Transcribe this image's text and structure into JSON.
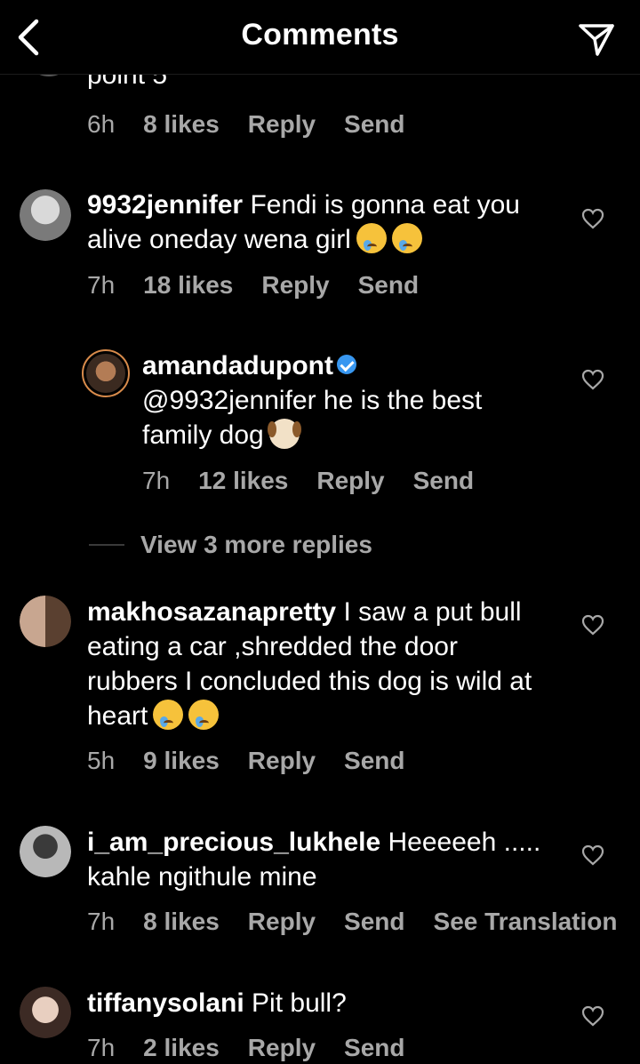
{
  "header": {
    "title": "Comments"
  },
  "partial": {
    "text": "point 5",
    "time": "6h",
    "likes": "8 likes",
    "reply": "Reply",
    "send": "Send"
  },
  "comments": [
    {
      "username": "9932jennifer",
      "text": "Fendi is gonna eat you alive oneday wena girl",
      "emojis": [
        "crying-face",
        "crying-face"
      ],
      "time": "7h",
      "likes": "18 likes",
      "reply": "Reply",
      "send": "Send"
    },
    {
      "username": "amandadupont",
      "verified": true,
      "text": "@9932jennifer he is the best family dog",
      "emojis": [
        "dog-face"
      ],
      "time": "7h",
      "likes": "12 likes",
      "reply": "Reply",
      "send": "Send"
    },
    {
      "username": "makhosazanapretty",
      "text": "I saw a put bull eating a car ,shredded the door rubbers I concluded this dog is wild at heart",
      "emojis": [
        "crying-face",
        "crying-face"
      ],
      "time": "5h",
      "likes": "9 likes",
      "reply": "Reply",
      "send": "Send"
    },
    {
      "username": "i_am_precious_lukhele",
      "text": "Heeeeeh ..... kahle ngithule mine",
      "time": "7h",
      "likes": "8 likes",
      "reply": "Reply",
      "send": "Send",
      "translate": "See Translation"
    },
    {
      "username": "tiffanysolani",
      "text": "Pit bull?",
      "time": "7h",
      "likes": "2 likes",
      "reply": "Reply",
      "send": "Send"
    }
  ],
  "view_more": "View 3 more replies",
  "colors": {
    "background": "#000000",
    "text": "#ffffff",
    "muted": "#a8a8a8",
    "verified": "#3897f0",
    "story_ring": "#d88b4b"
  }
}
